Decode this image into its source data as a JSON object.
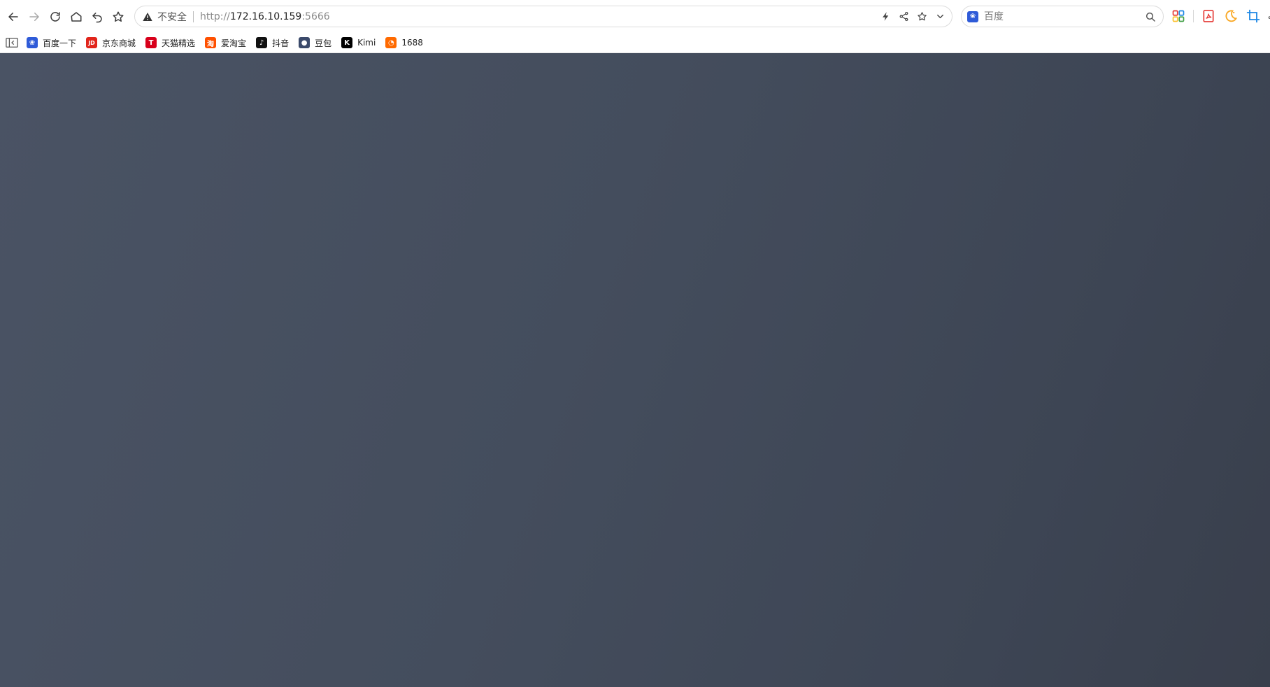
{
  "toolbar": {
    "security_label": "不安全",
    "url": {
      "scheme": "http://",
      "host": "172.16.10.159",
      "port": ":5666"
    }
  },
  "search": {
    "placeholder": "百度"
  },
  "bookmarks": [
    {
      "label": "百度一下",
      "icon": "baidu-icon",
      "color": "#2f5bd8",
      "glyph": "❀"
    },
    {
      "label": "京东商城",
      "icon": "jd-icon",
      "color": "#e1251b",
      "glyph": "JD"
    },
    {
      "label": "天猫精选",
      "icon": "tmall-icon",
      "color": "#d8001b",
      "glyph": "T"
    },
    {
      "label": "爱淘宝",
      "icon": "taobao-icon",
      "color": "#ff5000",
      "glyph": "淘"
    },
    {
      "label": "抖音",
      "icon": "douyin-icon",
      "color": "#111111",
      "glyph": "♪"
    },
    {
      "label": "豆包",
      "icon": "doubao-icon",
      "color": "#3b4a6b",
      "glyph": "●"
    },
    {
      "label": "Kimi",
      "icon": "kimi-icon",
      "color": "#000000",
      "glyph": "K"
    },
    {
      "label": "1688",
      "icon": "1688-icon",
      "color": "#ff6a00",
      "glyph": "◔"
    }
  ],
  "colors": {
    "content_background": "#444d5d",
    "accent_blue": "#1e88e5"
  }
}
